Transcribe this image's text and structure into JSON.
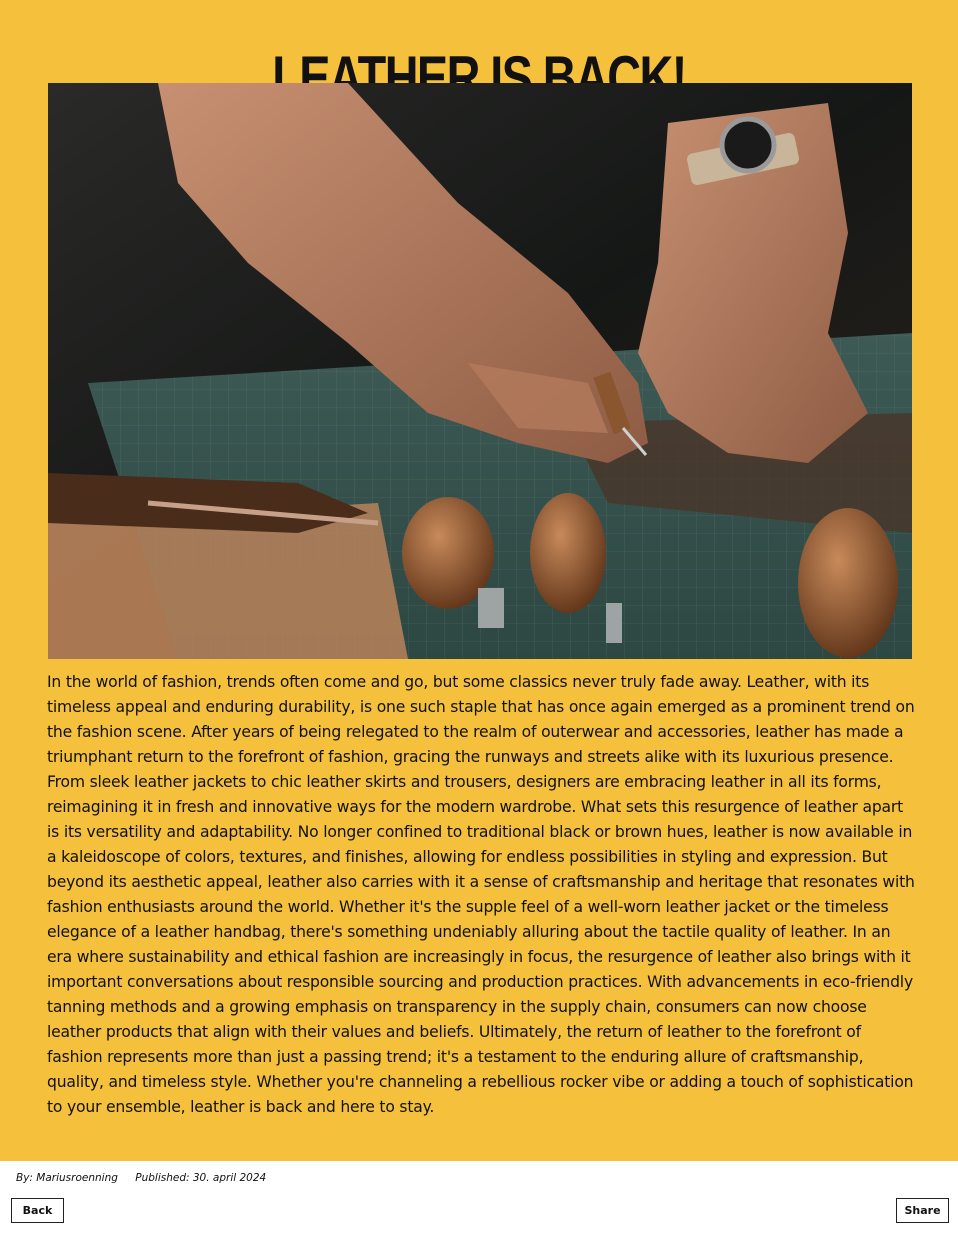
{
  "article": {
    "title": "Leather is back!",
    "image_alt": "Craftsman's hands cutting leather with a knife on a cutting mat beside leatherworking tools",
    "body": "In the world of fashion, trends often come and go, but some classics never truly fade away. Leather, with its timeless appeal and enduring durability, is one such staple that has once again emerged as a prominent trend on the fashion scene. After years of being relegated to the realm of outerwear and accessories, leather has made a triumphant return to the forefront of fashion, gracing the runways and streets alike with its luxurious presence. From sleek leather jackets to chic leather skirts and trousers, designers are embracing leather in all its forms, reimagining it in fresh and innovative ways for the modern wardrobe. What sets this resurgence of leather apart is its versatility and adaptability. No longer confined to traditional black or brown hues, leather is now available in a kaleidoscope of colors, textures, and finishes, allowing for endless possibilities in styling and expression. But beyond its aesthetic appeal, leather also carries with it a sense of craftsmanship and heritage that resonates with fashion enthusiasts around the world. Whether it's the supple feel of a well-worn leather jacket or the timeless elegance of a leather handbag, there's something undeniably alluring about the tactile quality of leather. In an era where sustainability and ethical fashion are increasingly in focus, the resurgence of leather also brings with it important conversations about responsible sourcing and production practices. With advancements in eco-friendly tanning methods and a growing emphasis on transparency in the supply chain, consumers can now choose leather products that align with their values and beliefs. Ultimately, the return of leather to the forefront of fashion represents more than just a passing trend; it's a testament to the enduring allure of craftsmanship, quality, and timeless style. Whether you're channeling a rebellious rocker vibe or adding a touch of sophistication to your ensemble, leather is back and here to stay."
  },
  "footer": {
    "author": "By: Mariusroenning",
    "published": "Published: 30. april 2024",
    "back_label": "Back",
    "share_label": "Share"
  },
  "colors": {
    "article_background": "#f5c13c",
    "footer_background": "#ffffff",
    "text": "#111111"
  }
}
